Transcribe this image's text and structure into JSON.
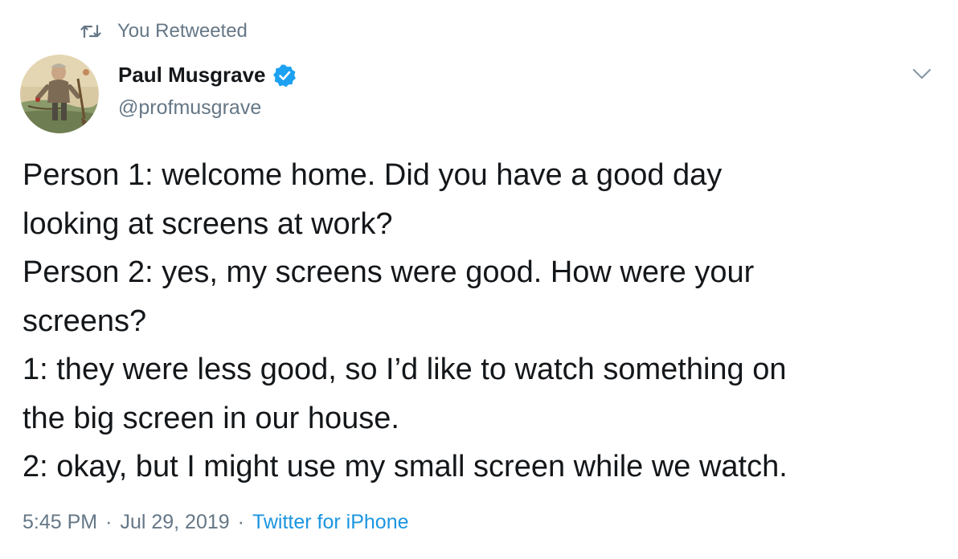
{
  "retweet_context": {
    "label": "You Retweeted",
    "icon": "retweet-icon"
  },
  "author": {
    "name": "Paul Musgrave",
    "handle": "@profmusgrave",
    "verified": true,
    "verified_icon": "verified-badge-icon"
  },
  "menu": {
    "icon": "chevron-down-icon"
  },
  "tweet": {
    "lines": [
      "Person 1: welcome home. Did you have a good day",
      "looking at screens at work?",
      "Person 2: yes, my screens were good. How were your",
      "screens?",
      "1: they were less good, so I’d like to watch something on",
      "the big screen in our house.",
      "2: okay, but I might use my small screen while we watch."
    ]
  },
  "meta": {
    "time": "5:45 PM",
    "separator": "·",
    "date": "Jul 29, 2019",
    "source": "Twitter for iPhone"
  },
  "colors": {
    "text": "#14171a",
    "secondary": "#657786",
    "link": "#1b95e0",
    "verified": "#1da1f2"
  }
}
